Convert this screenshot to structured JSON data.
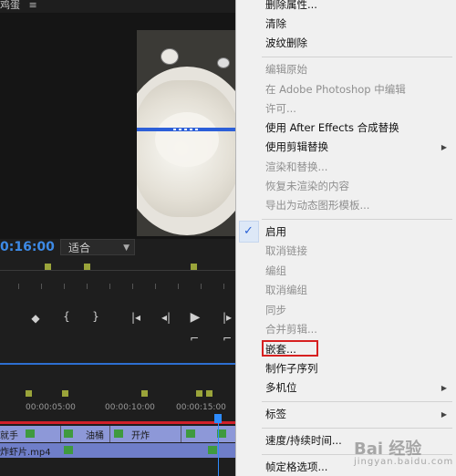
{
  "editor": {
    "panel_title": "鸡蛋",
    "timecode": "0:16:00",
    "fit_select": "适合",
    "timeline_labels": [
      "00:00:05:00",
      "00:00:10:00",
      "00:00:15:00"
    ],
    "video_track_labels": [
      "就手",
      "油桶",
      "开炸"
    ],
    "audio_track_label": "炸虾片.mp4",
    "colors": {
      "accent_blue": "#2d6fd1",
      "timecode": "#3d8ae6",
      "playhead_red": "#d0202a"
    }
  },
  "menu": {
    "items": [
      {
        "label": "删除属性...",
        "enabled": true
      },
      {
        "label": "清除",
        "enabled": true
      },
      {
        "label": "波纹删除",
        "enabled": true
      },
      {
        "label": "编辑原始",
        "enabled": false
      },
      {
        "label": "在 Adobe Photoshop 中编辑",
        "enabled": false
      },
      {
        "label": "许可...",
        "enabled": false
      },
      {
        "label": "使用 After Effects 合成替换",
        "enabled": true
      },
      {
        "label": "使用剪辑替换",
        "enabled": true,
        "submenu": true
      },
      {
        "label": "渲染和替换...",
        "enabled": false
      },
      {
        "label": "恢复未渲染的内容",
        "enabled": false
      },
      {
        "label": "导出为动态图形模板...",
        "enabled": false
      },
      {
        "label": "启用",
        "enabled": true,
        "checked": true
      },
      {
        "label": "取消链接",
        "enabled": false
      },
      {
        "label": "编组",
        "enabled": false
      },
      {
        "label": "取消编组",
        "enabled": false
      },
      {
        "label": "同步",
        "enabled": false
      },
      {
        "label": "合并剪辑...",
        "enabled": false
      },
      {
        "label": "嵌套...",
        "enabled": true,
        "highlighted": true
      },
      {
        "label": "制作子序列",
        "enabled": true
      },
      {
        "label": "多机位",
        "enabled": true,
        "submenu": true
      },
      {
        "label": "标签",
        "enabled": true,
        "submenu": true
      },
      {
        "label": "速度/持续时间...",
        "enabled": true
      },
      {
        "label": "帧定格选项...",
        "enabled": true
      }
    ]
  },
  "watermark": {
    "text": "Bai 经验",
    "sub": "jingyan.baidu.com"
  }
}
